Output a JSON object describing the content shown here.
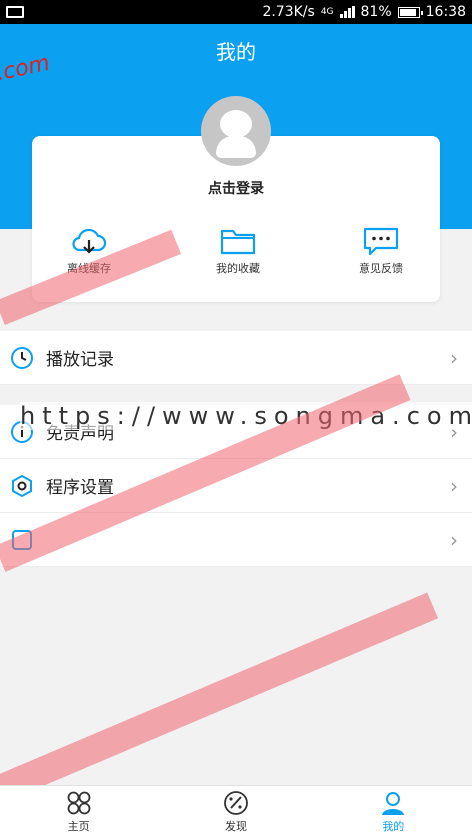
{
  "status_bar": {
    "speed": "2.73K/s",
    "network": "4G",
    "battery": "81%",
    "battery_level": 0.81,
    "time": "16:38"
  },
  "header": {
    "title": "我的",
    "bg_color": "#0ba0f0"
  },
  "profile": {
    "login_label": "点击登录"
  },
  "shortcuts": [
    {
      "label": "离线缓存",
      "icon": "cloud-download-icon"
    },
    {
      "label": "我的收藏",
      "icon": "folder-icon"
    },
    {
      "label": "意见反馈",
      "icon": "chat-bubble-icon"
    }
  ],
  "menu": [
    {
      "label": "播放记录",
      "icon": "clock-icon"
    },
    {
      "label": "免责声明",
      "icon": "info-icon"
    },
    {
      "label": "程序设置",
      "icon": "settings-hex-icon"
    },
    {
      "label": "",
      "icon": "square-icon"
    }
  ],
  "watermark": {
    "text": "https://www.songma.com",
    "corner_text": ".com"
  },
  "tabbar": [
    {
      "label": "主页",
      "icon": "grid-icon",
      "active": false
    },
    {
      "label": "发现",
      "icon": "palette-icon",
      "active": false
    },
    {
      "label": "我的",
      "icon": "user-icon",
      "active": true
    }
  ],
  "colors": {
    "accent": "#0ba0f0",
    "chevron": "#999999"
  }
}
